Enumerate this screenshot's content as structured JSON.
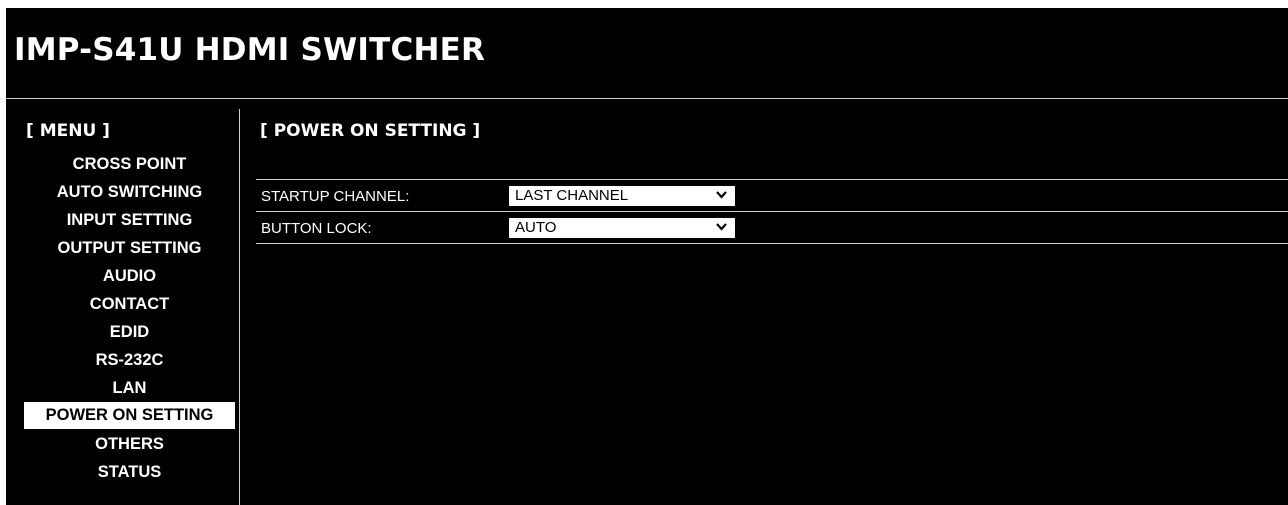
{
  "header": {
    "title": "IMP-S41U HDMI SWITCHER"
  },
  "sidebar": {
    "heading": "[ MENU ]",
    "items": [
      {
        "label": "CROSS POINT"
      },
      {
        "label": "AUTO SWITCHING"
      },
      {
        "label": "INPUT SETTING"
      },
      {
        "label": "OUTPUT SETTING"
      },
      {
        "label": "AUDIO"
      },
      {
        "label": "CONTACT"
      },
      {
        "label": "EDID"
      },
      {
        "label": "RS-232C"
      },
      {
        "label": "LAN"
      },
      {
        "label": "POWER ON SETTING",
        "active": true
      },
      {
        "label": "OTHERS"
      },
      {
        "label": "STATUS"
      }
    ]
  },
  "main": {
    "section_title": "[ POWER ON SETTING ]",
    "settings": [
      {
        "label": "STARTUP CHANNEL:",
        "value": "LAST CHANNEL",
        "icon": "chevron-down-icon"
      },
      {
        "label": "BUTTON LOCK:",
        "value": "AUTO",
        "icon": "chevron-down-icon"
      }
    ]
  },
  "colors": {
    "background": "#000000",
    "text": "#ffffff",
    "active_item_background": "#ffffff",
    "active_item_text": "#000000",
    "divider": "#cfcfcf"
  }
}
